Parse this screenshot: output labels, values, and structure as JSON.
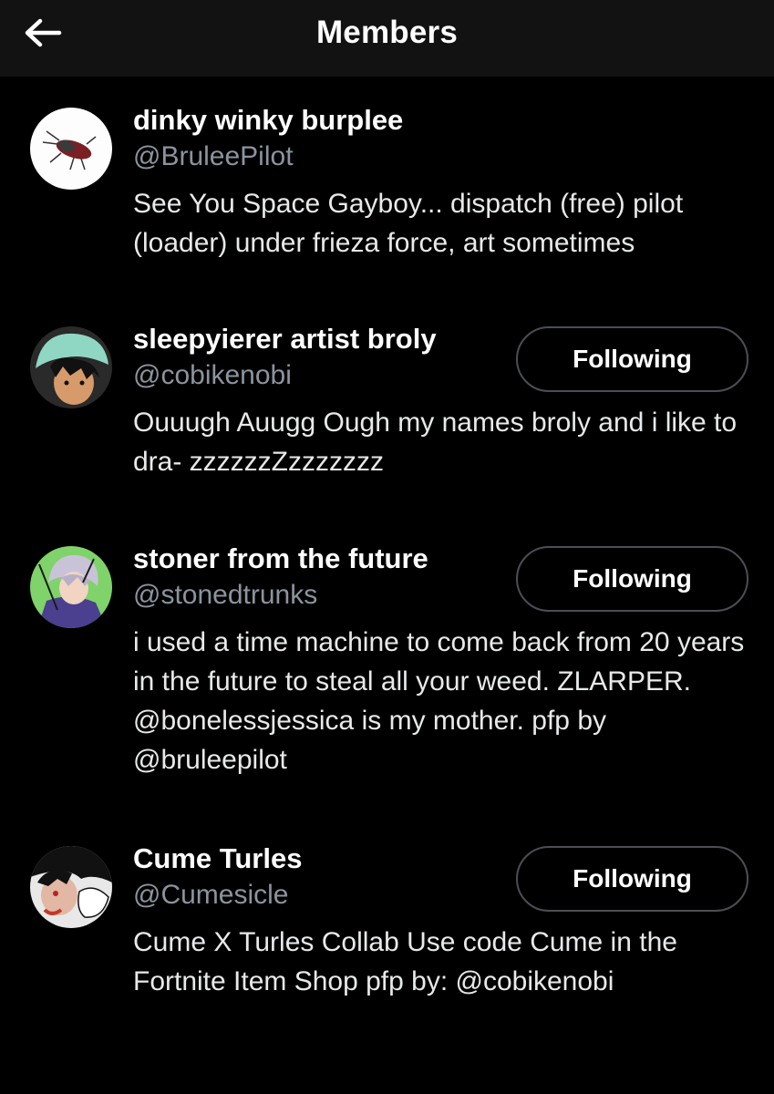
{
  "header": {
    "title": "Members",
    "back_icon": "arrow-left-icon"
  },
  "members": [
    {
      "name": "dinky winky burplee",
      "handle": "@BruleePilot",
      "bio": "See You Space Gayboy... dispatch (free) pilot (loader) under frieza force, art sometimes",
      "button_label": ""
    },
    {
      "name": "sleepyierer artist broly",
      "handle": "@cobikenobi",
      "bio": "Ouuugh Auugg Ough my names broly and i like to dra- zzzzzzZzzzzzzz",
      "button_label": "Following"
    },
    {
      "name": "stoner from the future",
      "handle": "@stonedtrunks",
      "bio": "i used a time machine to come back from 20 years in the future to steal all your weed. ZLARPER. @bonelessjessica is my mother. pfp by @bruleepilot",
      "button_label": "Following"
    },
    {
      "name": "Cume Turles",
      "handle": "@Cumesicle",
      "bio": "Cume X Turles Collab Use code Cume in the Fortnite Item Shop pfp by: @cobikenobi",
      "button_label": "Following"
    }
  ]
}
